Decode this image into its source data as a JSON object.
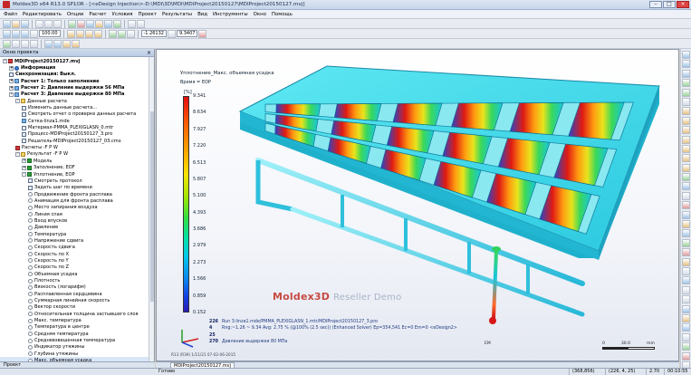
{
  "window": {
    "title": "Moldex3D  x64 R13.0 SP1OR - [<eDesign Injection>-D:\\MDI\\3D\\MDI\\MDIProject20150127\\MDIProject20150127.mvj]",
    "controls": [
      "–",
      "□",
      "×"
    ]
  },
  "menu": [
    "Файл",
    "Редактировать",
    "Опции",
    "Расчет",
    "Условия",
    "Проект",
    "Результаты",
    "Вид",
    "Инструменты",
    "Окно",
    "Помощь"
  ],
  "toolbar": {
    "zoom_value": "100.00",
    "coord_value": "-1.26132",
    "max_value": "9.3407"
  },
  "panel": {
    "title": "Окно проекта",
    "close": "×",
    "tab": "Проект",
    "tree": [
      {
        "label": "MDIProject20150127.mvj",
        "indent": 0,
        "icon": "red",
        "bold": true,
        "toggle": "-"
      },
      {
        "label": "Информация",
        "indent": 1,
        "icon": "info",
        "bold": true,
        "toggle": "+"
      },
      {
        "label": "Синхронизация: Выкл.",
        "indent": 1,
        "icon": "doc",
        "bold": true,
        "toggle": ""
      },
      {
        "label": "Расчет 1: Только заполнение",
        "indent": 1,
        "icon": "grid",
        "bold": true,
        "toggle": "+"
      },
      {
        "label": "Расчет 2: Давление выдержки 56 МПа",
        "indent": 1,
        "icon": "grid",
        "bold": true,
        "toggle": "+"
      },
      {
        "label": "Расчет 3: Давление выдержки 80 МПа",
        "indent": 1,
        "icon": "grid",
        "bold": true,
        "toggle": "-"
      },
      {
        "label": "Данные расчета",
        "indent": 2,
        "icon": "folder",
        "bold": false,
        "toggle": "-"
      },
      {
        "label": "Изменить данные расчета...",
        "indent": 3,
        "icon": "doc",
        "bold": false,
        "toggle": ""
      },
      {
        "label": "Смотреть отчет о проверке данных расчета",
        "indent": 3,
        "icon": "doc",
        "bold": false,
        "toggle": ""
      },
      {
        "label": "Сетка-linza1.mde",
        "indent": 3,
        "icon": "grid",
        "bold": false,
        "toggle": ""
      },
      {
        "label": "Материал-PMMA_PLEXIGLASN_0.mtr",
        "indent": 3,
        "icon": "doc",
        "bold": false,
        "toggle": ""
      },
      {
        "label": "Процесс-MDIProject20150127_3.pro",
        "indent": 3,
        "icon": "doc",
        "bold": false,
        "toggle": ""
      },
      {
        "label": "Решатель-MDIProject20150127_03.cmx",
        "indent": 3,
        "icon": "doc",
        "bold": false,
        "toggle": ""
      },
      {
        "label": "Расчеты -F P W",
        "indent": 2,
        "icon": "red",
        "bold": false,
        "toggle": ""
      },
      {
        "label": "Результат -F P W",
        "indent": 2,
        "icon": "folder",
        "bold": false,
        "toggle": "-"
      },
      {
        "label": "Модель",
        "indent": 3,
        "icon": "check",
        "bold": false,
        "toggle": "+"
      },
      {
        "label": "Заполнение, EOF",
        "indent": 3,
        "icon": "check",
        "bold": false,
        "toggle": "+"
      },
      {
        "label": "Уплотнение, EOP",
        "indent": 3,
        "icon": "check",
        "bold": false,
        "toggle": "-"
      },
      {
        "label": "Смотреть протокол",
        "indent": 4,
        "icon": "doc",
        "bold": false,
        "toggle": ""
      },
      {
        "label": "Задать шаг по времени",
        "indent": 4,
        "icon": "doc",
        "bold": false,
        "toggle": ""
      },
      {
        "label": "Продвижение фронта расплава",
        "indent": 4,
        "icon": "radio",
        "bold": false,
        "toggle": ""
      },
      {
        "label": "Анимация для фронта расплава",
        "indent": 4,
        "icon": "radio",
        "bold": false,
        "toggle": ""
      },
      {
        "label": "Место запирания воздуха",
        "indent": 4,
        "icon": "radio",
        "bold": false,
        "toggle": ""
      },
      {
        "label": "Линия спая",
        "indent": 4,
        "icon": "radio",
        "bold": false,
        "toggle": ""
      },
      {
        "label": "Вход впусков",
        "indent": 4,
        "icon": "radio",
        "bold": false,
        "toggle": ""
      },
      {
        "label": "Давление",
        "indent": 4,
        "icon": "radio",
        "bold": false,
        "toggle": ""
      },
      {
        "label": "Температура",
        "indent": 4,
        "icon": "radio",
        "bold": false,
        "toggle": ""
      },
      {
        "label": "Напряжение сдвига",
        "indent": 4,
        "icon": "radio",
        "bold": false,
        "toggle": ""
      },
      {
        "label": "Скорость сдвига",
        "indent": 4,
        "icon": "radio",
        "bold": false,
        "toggle": ""
      },
      {
        "label": "Скорость по X",
        "indent": 4,
        "icon": "radio",
        "bold": false,
        "toggle": ""
      },
      {
        "label": "Скорость по Y",
        "indent": 4,
        "icon": "radio",
        "bold": false,
        "toggle": ""
      },
      {
        "label": "Скорость по Z",
        "indent": 4,
        "icon": "radio",
        "bold": false,
        "toggle": ""
      },
      {
        "label": "Объемная усадка",
        "indent": 4,
        "icon": "radio",
        "bold": false,
        "toggle": ""
      },
      {
        "label": "Плотность",
        "indent": 4,
        "icon": "radio",
        "bold": false,
        "toggle": ""
      },
      {
        "label": "Вязкость (логарифм)",
        "indent": 4,
        "icon": "radio",
        "bold": false,
        "toggle": ""
      },
      {
        "label": "Расплавленная сердцевина",
        "indent": 4,
        "icon": "radio",
        "bold": false,
        "toggle": ""
      },
      {
        "label": "Суммарная линейная скорость",
        "indent": 4,
        "icon": "radio",
        "bold": false,
        "toggle": ""
      },
      {
        "label": "Вектор скорости",
        "indent": 4,
        "icon": "radio",
        "bold": false,
        "toggle": ""
      },
      {
        "label": "Относительная толщина застывшего слоя",
        "indent": 4,
        "icon": "radio",
        "bold": false,
        "toggle": ""
      },
      {
        "label": "Макс. температура",
        "indent": 4,
        "icon": "radio",
        "bold": false,
        "toggle": ""
      },
      {
        "label": "Температура в центре",
        "indent": 4,
        "icon": "radio",
        "bold": false,
        "toggle": ""
      },
      {
        "label": "Средняя температура",
        "indent": 4,
        "icon": "radio",
        "bold": false,
        "toggle": ""
      },
      {
        "label": "Средневзвешенная температура",
        "indent": 4,
        "icon": "radio",
        "bold": false,
        "toggle": ""
      },
      {
        "label": "Индикатор утяжины",
        "indent": 4,
        "icon": "radio",
        "bold": false,
        "toggle": ""
      },
      {
        "label": "Глубина утяжины",
        "indent": 4,
        "icon": "radio",
        "bold": false,
        "toggle": ""
      },
      {
        "label": "Макс. объемная усадка",
        "indent": 4,
        "icon": "radio",
        "bold": false,
        "toggle": "",
        "selected": true
      },
      {
        "label": "Вектор средней скорости",
        "indent": 4,
        "icon": "radio",
        "bold": false,
        "toggle": ""
      }
    ]
  },
  "viewport": {
    "tab_label": "MDIProject20150127.mvj",
    "legend": {
      "title": "Уплотнение_Макс. объемная усадка",
      "time": "Время = EOP",
      "unit": "[%]",
      "ticks": [
        "9.341",
        "8.634",
        "7.927",
        "7.220",
        "6.513",
        "5.807",
        "5.100",
        "4.393",
        "3.686",
        "2.979",
        "2.273",
        "1.566",
        "0.859",
        "0.152"
      ]
    },
    "brand": "Moldex3D",
    "brand_suffix": "Reseller Demo",
    "info": [
      {
        "label": "226",
        "text": "Run 3:linza1.mde/PMMA_PLEXIGLASN_1.mtr/MDIProject20150127_3.pro"
      },
      {
        "label": "4",
        "text": "Rng:~1.26 ~ 9.34  Avg: 2.75 %  (@100% (2.5 sec))  (Enhanced Solver) Ep=354,541 Ec=0 Em=0  <eDesign2>"
      },
      {
        "label": "25",
        "text": ""
      },
      {
        "label": "270",
        "text": "Давление выдержки 80 МПа"
      }
    ],
    "stamp": "R13 (R39) 1/11/21 07-02-06-2015",
    "em_label": "EM",
    "scale": {
      "min": "0",
      "mid": "30.0",
      "unit": "mm"
    }
  },
  "status": {
    "ready": "Готово",
    "cells": [
      "(368,856)",
      "(226, 4, 25)",
      "2.70",
      "00:10:55"
    ]
  }
}
